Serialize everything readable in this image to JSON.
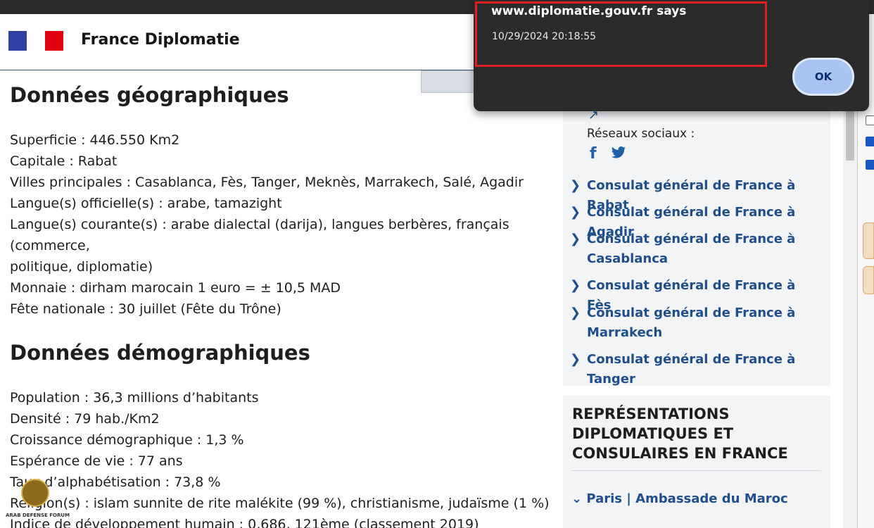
{
  "header": {
    "site_name": "France Diplomatie"
  },
  "geo": {
    "title": "Données géographiques",
    "lines": [
      "Superficie : 446.550 Km2",
      "Capitale : Rabat",
      "Villes principales : Casablanca, Fès, Tanger, Meknès, Marrakech, Salé, Agadir",
      "Langue(s) officielle(s) : arabe, tamazight",
      "Langue(s) courante(s) : arabe dialectal (darija), langues berbères, français",
      "(commerce,",
      "politique, diplomatie)",
      "Monnaie : dirham marocain 1 euro = ± 10,5 MAD",
      "Fête nationale : 30 juillet (Fête du Trône)"
    ]
  },
  "demo": {
    "title": "Données démographiques",
    "lines": [
      "Population : 36,3 millions d’habitants",
      "Densité : 79 hab./Km2",
      "Croissance démographique : 1,3 %",
      "Espérance de vie : 77 ans",
      "Taux d’alphabétisation : 73,8 %",
      "Religion(s) : islam sunnite de rite malékite (99 %), christianisme, judaïsme (1 %)",
      "Indice de développement humain : 0,686, 121ème (classement 2019)"
    ]
  },
  "watermark": {
    "text": "ARAB DEFENSE FORUM"
  },
  "sidebar": {
    "social_label": "Réseaux sociaux :",
    "consulates": [
      "Consulat général de France à Rabat",
      "Consulat général de France à Agadir",
      "Consulat général de France à Casablanca",
      "Consulat général de France à Fès",
      "Consulat général de France à Marrakech",
      "Consulat général de France à Tanger"
    ],
    "rep_title": "REPRÉSENTATIONS DIPLOMATIQUES ET CONSULAIRES EN FRANCE",
    "paris_link": "Paris | Ambassade du Maroc"
  },
  "dialog": {
    "title": "www.diplomatie.gouv.fr says",
    "message": "10/29/2024 20:18:55",
    "ok_label": "OK"
  },
  "colors": {
    "link": "#1f4e8c",
    "highlight_box": "#e02020",
    "ok_button": "#a8c4f2"
  }
}
